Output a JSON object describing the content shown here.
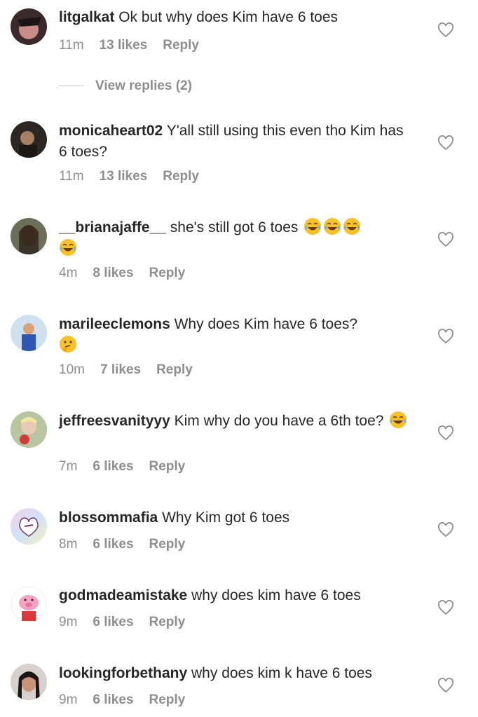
{
  "comments": [
    {
      "username": "litgalkat",
      "text": "Ok but why does Kim have 6 toes",
      "time": "11m",
      "likes": "13 likes",
      "reply": "Reply"
    },
    {
      "username": "monicaheart02",
      "text": "Y'all still using this even tho Kim has 6 toes?",
      "time": "11m",
      "likes": "13 likes",
      "reply": "Reply"
    },
    {
      "username": "__brianajaffe__",
      "text": "she's still got 6 toes",
      "time": "4m",
      "likes": "8 likes",
      "reply": "Reply"
    },
    {
      "username": "marileeclemons",
      "text": "Why does Kim have 6 toes?",
      "time": "10m",
      "likes": "7 likes",
      "reply": "Reply"
    },
    {
      "username": "jeffreesvanityyy",
      "text": "Kim why do you have a 6th toe?",
      "time": "7m",
      "likes": "6 likes",
      "reply": "Reply"
    },
    {
      "username": "blossommafia",
      "text": "Why Kim got 6 toes",
      "time": "8m",
      "likes": "6 likes",
      "reply": "Reply"
    },
    {
      "username": "godmadeamistake",
      "text": "why does kim have 6 toes",
      "time": "9m",
      "likes": "6 likes",
      "reply": "Reply"
    },
    {
      "username": "lookingforbethany",
      "text": "why does kim k have 6 toes",
      "time": "9m",
      "likes": "6 likes",
      "reply": "Reply"
    }
  ],
  "view_replies": "View replies (2)",
  "icons": {
    "like": "heart-outline-icon",
    "laugh": "tears-of-joy-emoji",
    "think": "thinking-face-emoji"
  },
  "colors": {
    "text": "#262626",
    "meta": "#8e8e8e",
    "emoji": "#f7c12b"
  }
}
